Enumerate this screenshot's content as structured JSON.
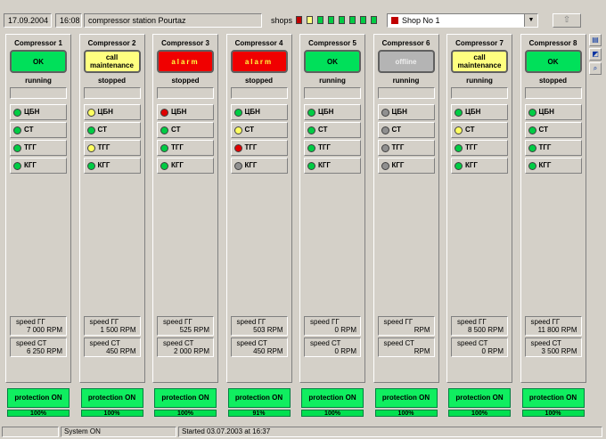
{
  "header": {
    "date": "17.09.2004",
    "time": "16:08",
    "station": "compressor station Pourtaz",
    "shops_label": "shops",
    "shop_indicators": [
      "#c00000",
      "#ffff80",
      "#00cc44",
      "#00cc44",
      "#00cc44",
      "#00cc44",
      "#00cc44",
      "#00cc44"
    ],
    "shop_selected": "Shop No 1",
    "up_icon": "arrow-up-icon"
  },
  "compressors": [
    {
      "name": "Compressor 1",
      "status": "OK",
      "status_type": "ok",
      "state": "running",
      "indicators": [
        {
          "label": "ЦБН",
          "color": "green"
        },
        {
          "label": "СТ",
          "color": "green"
        },
        {
          "label": "ТГГ",
          "color": "green"
        },
        {
          "label": "КГГ",
          "color": "green"
        }
      ],
      "speed_gg_label": "speed ГГ",
      "speed_gg": "7 000 RPM",
      "speed_ct_label": "speed СТ",
      "speed_ct": "6 250 RPM",
      "protection": "protection ON",
      "protection_pct": "100%"
    },
    {
      "name": "Compressor 2",
      "status": "call maintenance",
      "status_type": "maint",
      "state": "stopped",
      "indicators": [
        {
          "label": "ЦБН",
          "color": "yellow"
        },
        {
          "label": "СТ",
          "color": "green"
        },
        {
          "label": "ТГГ",
          "color": "yellow"
        },
        {
          "label": "КГГ",
          "color": "green"
        }
      ],
      "speed_gg_label": "speed ГГ",
      "speed_gg": "1 500 RPM",
      "speed_ct_label": "speed СТ",
      "speed_ct": "450 RPM",
      "protection": "protection ON",
      "protection_pct": "100%"
    },
    {
      "name": "Compressor 3",
      "status": "alarm",
      "status_type": "alarm",
      "state": "stopped",
      "indicators": [
        {
          "label": "ЦБН",
          "color": "red"
        },
        {
          "label": "СТ",
          "color": "green"
        },
        {
          "label": "ТГГ",
          "color": "green"
        },
        {
          "label": "КГГ",
          "color": "green"
        }
      ],
      "speed_gg_label": "speed ГГ",
      "speed_gg": "525 RPM",
      "speed_ct_label": "speed СТ",
      "speed_ct": "2 000 RPM",
      "protection": "protection ON",
      "protection_pct": "100%"
    },
    {
      "name": "Compressor 4",
      "status": "alarm",
      "status_type": "alarm",
      "state": "stopped",
      "indicators": [
        {
          "label": "ЦБН",
          "color": "green"
        },
        {
          "label": "СТ",
          "color": "yellow"
        },
        {
          "label": "ТГГ",
          "color": "red"
        },
        {
          "label": "КГГ",
          "color": "gray"
        }
      ],
      "speed_gg_label": "speed ГГ",
      "speed_gg": "503 RPM",
      "speed_ct_label": "speed СТ",
      "speed_ct": "450 RPM",
      "protection": "protection ON",
      "protection_pct": "91%"
    },
    {
      "name": "Compressor 5",
      "status": "OK",
      "status_type": "ok",
      "state": "running",
      "indicators": [
        {
          "label": "ЦБН",
          "color": "green"
        },
        {
          "label": "СТ",
          "color": "green"
        },
        {
          "label": "ТГГ",
          "color": "green"
        },
        {
          "label": "КГГ",
          "color": "green"
        }
      ],
      "speed_gg_label": "speed ГГ",
      "speed_gg": "0 RPM",
      "speed_ct_label": "speed СТ",
      "speed_ct": "0 RPM",
      "protection": "protection ON",
      "protection_pct": "100%"
    },
    {
      "name": "Compressor 6",
      "status": "offline",
      "status_type": "off",
      "state": "running",
      "indicators": [
        {
          "label": "ЦБН",
          "color": "gray"
        },
        {
          "label": "СТ",
          "color": "gray"
        },
        {
          "label": "ТГГ",
          "color": "gray"
        },
        {
          "label": "КГГ",
          "color": "gray"
        }
      ],
      "speed_gg_label": "speed ГГ",
      "speed_gg": "RPM",
      "speed_ct_label": "speed СТ",
      "speed_ct": "RPM",
      "protection": "protection ON",
      "protection_pct": "100%"
    },
    {
      "name": "Compressor 7",
      "status": "call maintenance",
      "status_type": "maint",
      "state": "running",
      "indicators": [
        {
          "label": "ЦБН",
          "color": "green"
        },
        {
          "label": "СТ",
          "color": "yellow"
        },
        {
          "label": "ТГГ",
          "color": "green"
        },
        {
          "label": "КГГ",
          "color": "green"
        }
      ],
      "speed_gg_label": "speed ГГ",
      "speed_gg": "8 500 RPM",
      "speed_ct_label": "speed СТ",
      "speed_ct": "0 RPM",
      "protection": "protection ON",
      "protection_pct": "100%"
    },
    {
      "name": "Compressor 8",
      "status": "OK",
      "status_type": "ok",
      "state": "stopped",
      "indicators": [
        {
          "label": "ЦБН",
          "color": "green"
        },
        {
          "label": "СТ",
          "color": "green"
        },
        {
          "label": "ТГГ",
          "color": "green"
        },
        {
          "label": "КГГ",
          "color": "green"
        }
      ],
      "speed_gg_label": "speed ГГ",
      "speed_gg": "11 800 RPM",
      "speed_ct_label": "speed СТ",
      "speed_ct": "3 500 RPM",
      "protection": "protection ON",
      "protection_pct": "100%"
    }
  ],
  "side_tools": [
    "report-icon",
    "chart-icon",
    "zoom-icon"
  ],
  "statusbar": {
    "system": "System ON",
    "started": "Started 03.07.2003 at 16:37"
  }
}
